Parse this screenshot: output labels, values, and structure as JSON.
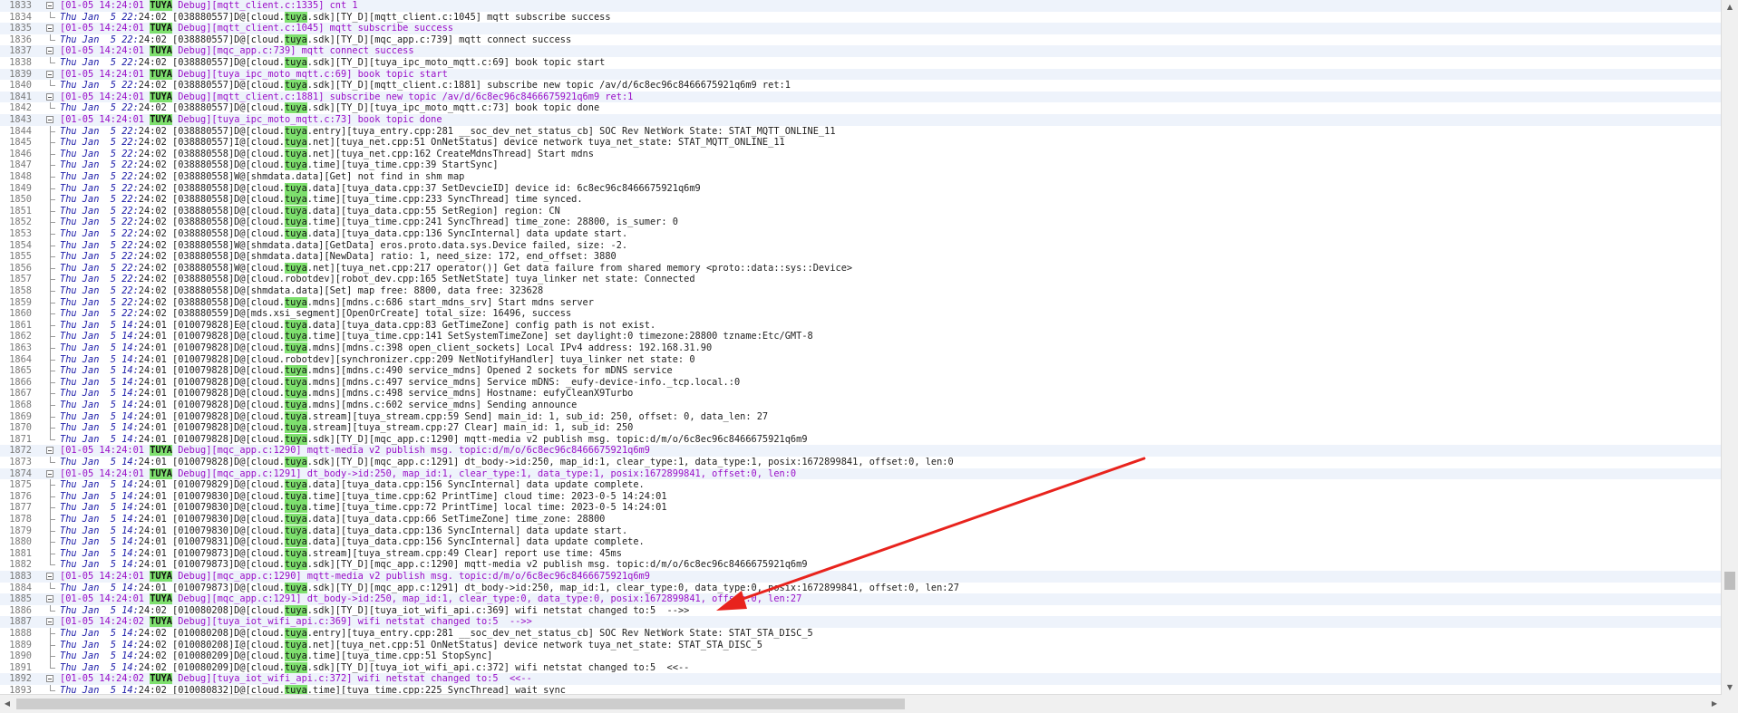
{
  "lines": [
    {
      "n": "1833",
      "k": "h",
      "ts": "[01-05 14:24:01 ",
      "tag": "TUYA",
      "b": " Debug][mqtt_client.c:1335] cnt 1"
    },
    {
      "n": "1834",
      "k": "s",
      "ts": "Thu Jan  5 22:",
      "b": "24:02 [038880557]D@[cloud.",
      "hl": "tuya",
      "b2": ".sdk][TY_D][mqtt_client.c:1045] mqtt subscribe success"
    },
    {
      "n": "1835",
      "k": "h",
      "ts": "[01-05 14:24:01 ",
      "tag": "TUYA",
      "b": " Debug][mqtt_client.c:1045] mqtt subscribe success"
    },
    {
      "n": "1836",
      "k": "s",
      "ts": "Thu Jan  5 22:",
      "b": "24:02 [038880557]D@[cloud.",
      "hl": "tuya",
      "b2": ".sdk][TY_D][mqc_app.c:739] mqtt connect success"
    },
    {
      "n": "1837",
      "k": "h",
      "ts": "[01-05 14:24:01 ",
      "tag": "TUYA",
      "b": " Debug][mqc_app.c:739] mqtt connect success"
    },
    {
      "n": "1838",
      "k": "s",
      "ts": "Thu Jan  5 22:",
      "b": "24:02 [038880557]D@[cloud.",
      "hl": "tuya",
      "b2": ".sdk][TY_D][tuya_ipc_moto_mqtt.c:69] book topic start"
    },
    {
      "n": "1839",
      "k": "h",
      "ts": "[01-05 14:24:01 ",
      "tag": "TUYA",
      "b": " Debug][tuya_ipc_moto_mqtt.c:69] book topic start"
    },
    {
      "n": "1840",
      "k": "s",
      "ts": "Thu Jan  5 22:",
      "b": "24:02 [038880557]D@[cloud.",
      "hl": "tuya",
      "b2": ".sdk][TY_D][mqtt_client.c:1881] subscribe new topic /av/d/6c8ec96c8466675921q6m9 ret:1"
    },
    {
      "n": "1841",
      "k": "h",
      "ts": "[01-05 14:24:01 ",
      "tag": "TUYA",
      "b": " Debug][mqtt_client.c:1881] subscribe new topic /av/d/6c8ec96c8466675921q6m9 ret:1"
    },
    {
      "n": "1842",
      "k": "s",
      "ts": "Thu Jan  5 22:",
      "b": "24:02 [038880557]D@[cloud.",
      "hl": "tuya",
      "b2": ".sdk][TY_D][tuya_ipc_moto_mqtt.c:73] book topic done"
    },
    {
      "n": "1843",
      "k": "h",
      "ts": "[01-05 14:24:01 ",
      "tag": "TUYA",
      "b": " Debug][tuya_ipc_moto_mqtt.c:73] book topic done"
    },
    {
      "n": "1844",
      "k": "s",
      "ts": "Thu Jan  5 22:",
      "b": "24:02 [038880557]D@[cloud.",
      "hl": "tuya",
      "b2": ".entry][tuya_entry.cpp:281 __soc_dev_net_status_cb] SOC Rev NetWork State: STAT_MQTT_ONLINE_11"
    },
    {
      "n": "1845",
      "k": "s",
      "ts": "Thu Jan  5 22:",
      "b": "24:02 [038880557]I@[cloud.",
      "hl": "tuya",
      "b2": ".net][tuya_net.cpp:51 OnNetStatus] device network tuya_net_state: STAT_MQTT_ONLINE_11"
    },
    {
      "n": "1846",
      "k": "s",
      "ts": "Thu Jan  5 22:",
      "b": "24:02 [038880558]D@[cloud.",
      "hl": "tuya",
      "b2": ".net][tuya_net.cpp:162 CreateMdnsThread] Start mdns"
    },
    {
      "n": "1847",
      "k": "s",
      "ts": "Thu Jan  5 22:",
      "b": "24:02 [038880558]D@[cloud.",
      "hl": "tuya",
      "b2": ".time][tuya_time.cpp:39 StartSync]"
    },
    {
      "n": "1848",
      "k": "s",
      "ts": "Thu Jan  5 22:",
      "b": "24:02 [038880558]W@[shmdata.data][Get] not find in shm map",
      "hl": "",
      "b2": ""
    },
    {
      "n": "1849",
      "k": "s",
      "ts": "Thu Jan  5 22:",
      "b": "24:02 [038880558]D@[cloud.",
      "hl": "tuya",
      "b2": ".data][tuya_data.cpp:37 SetDevcieID] device id: 6c8ec96c8466675921q6m9"
    },
    {
      "n": "1850",
      "k": "s",
      "ts": "Thu Jan  5 22:",
      "b": "24:02 [038880558]D@[cloud.",
      "hl": "tuya",
      "b2": ".time][tuya_time.cpp:233 SyncThread] time synced."
    },
    {
      "n": "1851",
      "k": "s",
      "ts": "Thu Jan  5 22:",
      "b": "24:02 [038880558]D@[cloud.",
      "hl": "tuya",
      "b2": ".data][tuya_data.cpp:55 SetRegion] region: CN"
    },
    {
      "n": "1852",
      "k": "s",
      "ts": "Thu Jan  5 22:",
      "b": "24:02 [038880558]D@[cloud.",
      "hl": "tuya",
      "b2": ".time][tuya_time.cpp:241 SyncThread] time_zone: 28800, is_sumer: 0"
    },
    {
      "n": "1853",
      "k": "s",
      "ts": "Thu Jan  5 22:",
      "b": "24:02 [038880558]D@[cloud.",
      "hl": "tuya",
      "b2": ".data][tuya_data.cpp:136 SyncInternal] data update start."
    },
    {
      "n": "1854",
      "k": "s",
      "ts": "Thu Jan  5 22:",
      "b": "24:02 [038880558]W@[shmdata.data][GetData] eros.proto.data.sys.Device failed, size: -2.",
      "hl": "",
      "b2": ""
    },
    {
      "n": "1855",
      "k": "s",
      "ts": "Thu Jan  5 22:",
      "b": "24:02 [038880558]D@[shmdata.data][NewData] ratio: 1, need_size: 172, end_offset: 3880",
      "hl": "",
      "b2": ""
    },
    {
      "n": "1856",
      "k": "s",
      "ts": "Thu Jan  5 22:",
      "b": "24:02 [038880558]W@[cloud.",
      "hl": "tuya",
      "b2": ".net][tuya_net.cpp:217 operator()] Get data failure from shared memory <proto::data::sys::Device>"
    },
    {
      "n": "1857",
      "k": "s",
      "ts": "Thu Jan  5 22:",
      "b": "24:02 [038880558]D@[cloud.robotdev][robot_dev.cpp:165 SetNetState] tuya_linker net state: Connected",
      "hl": "",
      "b2": ""
    },
    {
      "n": "1858",
      "k": "s",
      "ts": "Thu Jan  5 22:",
      "b": "24:02 [038880558]D@[shmdata.data][Set] map free: 8800, data free: 323628",
      "hl": "",
      "b2": ""
    },
    {
      "n": "1859",
      "k": "s",
      "ts": "Thu Jan  5 22:",
      "b": "24:02 [038880558]D@[cloud.",
      "hl": "tuya",
      "b2": ".mdns][mdns.c:686 start_mdns_srv] Start mdns server"
    },
    {
      "n": "1860",
      "k": "s",
      "ts": "Thu Jan  5 22:",
      "b": "24:02 [038880559]D@[mds.xsi_segment][OpenOrCreate] total_size: 16496, success",
      "hl": "",
      "b2": ""
    },
    {
      "n": "1861",
      "k": "s",
      "ts": "Thu Jan  5 14:",
      "b": "24:01 [010079828]E@[cloud.",
      "hl": "tuya",
      "b2": ".data][tuya_data.cpp:83 GetTimeZone] config path is not exist."
    },
    {
      "n": "1862",
      "k": "s",
      "ts": "Thu Jan  5 14:",
      "b": "24:01 [010079828]D@[cloud.",
      "hl": "tuya",
      "b2": ".time][tuya_time.cpp:141 SetSystemTimeZone] set daylight:0 timezone:28800 tzname:Etc/GMT-8"
    },
    {
      "n": "1863",
      "k": "s",
      "ts": "Thu Jan  5 14:",
      "b": "24:01 [010079828]D@[cloud.",
      "hl": "tuya",
      "b2": ".mdns][mdns.c:398 open_client_sockets] Local IPv4 address: 192.168.31.90"
    },
    {
      "n": "1864",
      "k": "s",
      "ts": "Thu Jan  5 14:",
      "b": "24:01 [010079828]D@[cloud.robotdev][synchronizer.cpp:209 NetNotifyHandler] tuya_linker net state: 0",
      "hl": "",
      "b2": ""
    },
    {
      "n": "1865",
      "k": "s",
      "ts": "Thu Jan  5 14:",
      "b": "24:01 [010079828]D@[cloud.",
      "hl": "tuya",
      "b2": ".mdns][mdns.c:490 service_mdns] Opened 2 sockets for mDNS service"
    },
    {
      "n": "1866",
      "k": "s",
      "ts": "Thu Jan  5 14:",
      "b": "24:01 [010079828]D@[cloud.",
      "hl": "tuya",
      "b2": ".mdns][mdns.c:497 service_mdns] Service mDNS: _eufy-device-info._tcp.local.:0"
    },
    {
      "n": "1867",
      "k": "s",
      "ts": "Thu Jan  5 14:",
      "b": "24:01 [010079828]D@[cloud.",
      "hl": "tuya",
      "b2": ".mdns][mdns.c:498 service_mdns] Hostname: eufyCleanX9Turbo"
    },
    {
      "n": "1868",
      "k": "s",
      "ts": "Thu Jan  5 14:",
      "b": "24:01 [010079828]D@[cloud.",
      "hl": "tuya",
      "b2": ".mdns][mdns.c:602 service_mdns] Sending announce"
    },
    {
      "n": "1869",
      "k": "s",
      "ts": "Thu Jan  5 14:",
      "b": "24:01 [010079828]D@[cloud.",
      "hl": "tuya",
      "b2": ".stream][tuya_stream.cpp:59 Send] main_id: 1, sub_id: 250, offset: 0, data_len: 27"
    },
    {
      "n": "1870",
      "k": "s",
      "ts": "Thu Jan  5 14:",
      "b": "24:01 [010079828]D@[cloud.",
      "hl": "tuya",
      "b2": ".stream][tuya_stream.cpp:27 Clear] main_id: 1, sub_id: 250"
    },
    {
      "n": "1871",
      "k": "s",
      "ts": "Thu Jan  5 14:",
      "b": "24:01 [010079828]D@[cloud.",
      "hl": "tuya",
      "b2": ".sdk][TY_D][mqc_app.c:1290] mqtt-media v2 publish msg. topic:d/m/o/6c8ec96c8466675921q6m9"
    },
    {
      "n": "1872",
      "k": "h",
      "ts": "[01-05 14:24:01 ",
      "tag": "TUYA",
      "b": " Debug][mqc_app.c:1290] mqtt-media v2 publish msg. topic:d/m/o/6c8ec96c8466675921q6m9"
    },
    {
      "n": "1873",
      "k": "s",
      "ts": "Thu Jan  5 14:",
      "b": "24:01 [010079828]D@[cloud.",
      "hl": "tuya",
      "b2": ".sdk][TY_D][mqc_app.c:1291] dt_body->id:250, map_id:1, clear_type:1, data_type:1, posix:1672899841, offset:0, len:0"
    },
    {
      "n": "1874",
      "k": "h",
      "ts": "[01-05 14:24:01 ",
      "tag": "TUYA",
      "b": " Debug][mqc_app.c:1291] dt_body->id:250, map_id:1, clear_type:1, data_type:1, posix:1672899841, offset:0, len:0"
    },
    {
      "n": "1875",
      "k": "s",
      "ts": "Thu Jan  5 14:",
      "b": "24:01 [010079829]D@[cloud.",
      "hl": "tuya",
      "b2": ".data][tuya_data.cpp:156 SyncInternal] data update complete."
    },
    {
      "n": "1876",
      "k": "s",
      "ts": "Thu Jan  5 14:",
      "b": "24:01 [010079830]D@[cloud.",
      "hl": "tuya",
      "b2": ".time][tuya_time.cpp:62 PrintTime] cloud time: 2023-0-5 14:24:01"
    },
    {
      "n": "1877",
      "k": "s",
      "ts": "Thu Jan  5 14:",
      "b": "24:01 [010079830]D@[cloud.",
      "hl": "tuya",
      "b2": ".time][tuya_time.cpp:72 PrintTime] local time: 2023-0-5 14:24:01"
    },
    {
      "n": "1878",
      "k": "s",
      "ts": "Thu Jan  5 14:",
      "b": "24:01 [010079830]D@[cloud.",
      "hl": "tuya",
      "b2": ".data][tuya_data.cpp:66 SetTimeZone] time_zone: 28800"
    },
    {
      "n": "1879",
      "k": "s",
      "ts": "Thu Jan  5 14:",
      "b": "24:01 [010079830]D@[cloud.",
      "hl": "tuya",
      "b2": ".data][tuya_data.cpp:136 SyncInternal] data update start."
    },
    {
      "n": "1880",
      "k": "s",
      "ts": "Thu Jan  5 14:",
      "b": "24:01 [010079831]D@[cloud.",
      "hl": "tuya",
      "b2": ".data][tuya_data.cpp:156 SyncInternal] data update complete."
    },
    {
      "n": "1881",
      "k": "s",
      "ts": "Thu Jan  5 14:",
      "b": "24:01 [010079873]D@[cloud.",
      "hl": "tuya",
      "b2": ".stream][tuya_stream.cpp:49 Clear] report use time: 45ms"
    },
    {
      "n": "1882",
      "k": "s",
      "ts": "Thu Jan  5 14:",
      "b": "24:01 [010079873]D@[cloud.",
      "hl": "tuya",
      "b2": ".sdk][TY_D][mqc_app.c:1290] mqtt-media v2 publish msg. topic:d/m/o/6c8ec96c8466675921q6m9"
    },
    {
      "n": "1883",
      "k": "h",
      "ts": "[01-05 14:24:01 ",
      "tag": "TUYA",
      "b": " Debug][mqc_app.c:1290] mqtt-media v2 publish msg. topic:d/m/o/6c8ec96c8466675921q6m9"
    },
    {
      "n": "1884",
      "k": "s",
      "ts": "Thu Jan  5 14:",
      "b": "24:01 [010079873]D@[cloud.",
      "hl": "tuya",
      "b2": ".sdk][TY_D][mqc_app.c:1291] dt_body->id:250, map_id:1, clear_type:0, data_type:0, posix:1672899841, offset:0, len:27"
    },
    {
      "n": "1885",
      "k": "h",
      "ts": "[01-05 14:24:01 ",
      "tag": "TUYA",
      "b": " Debug][mqc_app.c:1291] dt_body->id:250, map_id:1, clear_type:0, data_type:0, posix:1672899841, offset:0, len:27"
    },
    {
      "n": "1886",
      "k": "s",
      "ts": "Thu Jan  5 14:",
      "b": "24:02 [010080208]D@[cloud.",
      "hl": "tuya",
      "b2": ".sdk][TY_D][tuya_iot_wifi_api.c:369] wifi netstat changed to:5  -->>"
    },
    {
      "n": "1887",
      "k": "h",
      "ts": "[01-05 14:24:02 ",
      "tag": "TUYA",
      "b": " Debug][tuya_iot_wifi_api.c:369] wifi netstat changed to:5  -->>"
    },
    {
      "n": "1888",
      "k": "s",
      "ts": "Thu Jan  5 14:",
      "b": "24:02 [010080208]D@[cloud.",
      "hl": "tuya",
      "b2": ".entry][tuya_entry.cpp:281 __soc_dev_net_status_cb] SOC Rev NetWork State: STAT_STA_DISC_5"
    },
    {
      "n": "1889",
      "k": "s",
      "ts": "Thu Jan  5 14:",
      "b": "24:02 [010080208]I@[cloud.",
      "hl": "tuya",
      "b2": ".net][tuya_net.cpp:51 OnNetStatus] device network tuya_net_state: STAT_STA_DISC_5"
    },
    {
      "n": "1890",
      "k": "s",
      "ts": "Thu Jan  5 14:",
      "b": "24:02 [010080209]D@[cloud.",
      "hl": "tuya",
      "b2": ".time][tuya_time.cpp:51 StopSync]"
    },
    {
      "n": "1891",
      "k": "s",
      "ts": "Thu Jan  5 14:",
      "b": "24:02 [010080209]D@[cloud.",
      "hl": "tuya",
      "b2": ".sdk][TY_D][tuya_iot_wifi_api.c:372] wifi netstat changed to:5  <<--"
    },
    {
      "n": "1892",
      "k": "h",
      "ts": "[01-05 14:24:02 ",
      "tag": "TUYA",
      "b": " Debug][tuya_iot_wifi_api.c:372] wifi netstat changed to:5  <<--"
    },
    {
      "n": "1893",
      "k": "s",
      "ts": "Thu Jan  5 14:",
      "b": "24:02 [010080832]D@[cloud.",
      "hl": "tuya",
      "b2": ".time][tuya_time.cpp:225 SyncThread] wait sync"
    }
  ],
  "scrollbars": {
    "up_arrow": "▲",
    "down_arrow": "▼",
    "left_arrow": "◀",
    "right_arrow": "▶",
    "vertical_thumb_position": 0.86,
    "horizontal_thumb_position": 0.0
  },
  "annotation": {
    "color": "#e8231d",
    "kind": "red-arrow"
  }
}
